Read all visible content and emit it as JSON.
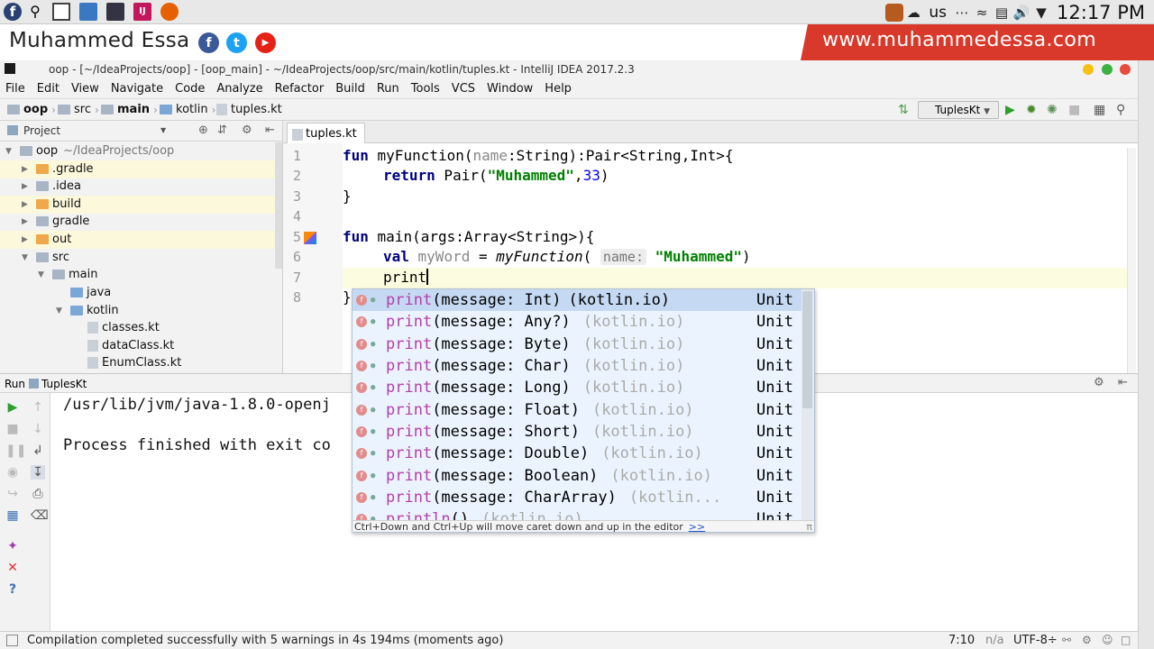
{
  "system_tray": {
    "language": "us",
    "clock": "12:17 PM"
  },
  "banner": {
    "name": "Muhammed Essa",
    "website": "www.muhammedessa.com",
    "social": [
      "f",
      "t",
      "▶"
    ]
  },
  "window": {
    "title": "oop - [~/IdeaProjects/oop] - [oop_main] - ~/IdeaProjects/oop/src/main/kotlin/tuples.kt - IntelliJ IDEA 2017.2.3"
  },
  "menu": [
    "File",
    "Edit",
    "View",
    "Navigate",
    "Code",
    "Analyze",
    "Refactor",
    "Build",
    "Run",
    "Tools",
    "VCS",
    "Window",
    "Help"
  ],
  "breadcrumbs": [
    "oop",
    "src",
    "main",
    "kotlin",
    "tuples.kt"
  ],
  "run_config": "TuplesKt",
  "project_panel": {
    "title": "Project",
    "tree": [
      {
        "label": "oop",
        "note": "~/IdeaProjects/oop"
      },
      {
        "label": ".gradle"
      },
      {
        "label": ".idea"
      },
      {
        "label": "build"
      },
      {
        "label": "gradle"
      },
      {
        "label": "out"
      },
      {
        "label": "src"
      },
      {
        "label": "main"
      },
      {
        "label": "java"
      },
      {
        "label": "kotlin"
      },
      {
        "label": "classes.kt"
      },
      {
        "label": "dataClass.kt"
      },
      {
        "label": "EnumClass.kt"
      }
    ]
  },
  "editor": {
    "tab": "tuples.kt",
    "line_numbers": [
      "1",
      "2",
      "3",
      "4",
      "5",
      "6",
      "7",
      "8"
    ],
    "code": {
      "l1_fun": "fun",
      "l1_name": " myFunction(",
      "l1_param": "name",
      "l1_rest": ":String):Pair<String,Int>{",
      "l2_return": "return",
      "l2_pair": " Pair(",
      "l2_str": "\"Muhammed\"",
      "l2_comma": ",",
      "l2_num": "33",
      "l2_close": ")",
      "l3": "}",
      "l5_fun": "fun",
      "l5_rest": " main(args:Array<String>){",
      "l6_val": "val",
      "l6_var": " myWord",
      "l6_eq": " = ",
      "l6_call": "myFunction",
      "l6_paren": "( ",
      "l6_hint": "name:",
      "l6_str": "\"Muhammed\"",
      "l6_close": ")",
      "l7": "print",
      "l8": "}"
    }
  },
  "completion": {
    "items": [
      {
        "name": "print",
        "sig": "(message: Int)",
        "pkg": "(kotlin.io)",
        "type": "Unit"
      },
      {
        "name": "print",
        "sig": "(message: Any?)",
        "pkg": "(kotlin.io)",
        "type": "Unit"
      },
      {
        "name": "print",
        "sig": "(message: Byte)",
        "pkg": "(kotlin.io)",
        "type": "Unit"
      },
      {
        "name": "print",
        "sig": "(message: Char)",
        "pkg": "(kotlin.io)",
        "type": "Unit"
      },
      {
        "name": "print",
        "sig": "(message: Long)",
        "pkg": "(kotlin.io)",
        "type": "Unit"
      },
      {
        "name": "print",
        "sig": "(message: Float)",
        "pkg": "(kotlin.io)",
        "type": "Unit"
      },
      {
        "name": "print",
        "sig": "(message: Short)",
        "pkg": "(kotlin.io)",
        "type": "Unit"
      },
      {
        "name": "print",
        "sig": "(message: Double)",
        "pkg": "(kotlin.io)",
        "type": "Unit"
      },
      {
        "name": "print",
        "sig": "(message: Boolean)",
        "pkg": "(kotlin.io)",
        "type": "Unit"
      },
      {
        "name": "print",
        "sig": "(message: CharArray)",
        "pkg": "(kotlin...",
        "type": "Unit"
      },
      {
        "name": "println",
        "sig": "()",
        "pkg": "(kotlin.io)",
        "type": "Unit"
      }
    ],
    "footer": "Ctrl+Down and Ctrl+Up will move caret down and up in the editor",
    "footer_link": ">>"
  },
  "run_panel": {
    "label": "Run",
    "config": "TuplesKt",
    "console": [
      "/usr/lib/jvm/java-1.8.0-openj",
      "Process finished with exit co"
    ]
  },
  "status_bar": {
    "message": "Compilation completed successfully with 5 warnings in 4s 194ms (moments ago)",
    "position": "7:10",
    "na": "n/a",
    "encoding": "UTF-8÷"
  },
  "colors": {
    "banner_red": "#d9392b",
    "facebook": "#3b5998",
    "twitter": "#1da1f2",
    "youtube": "#e62117",
    "keyword": "#000080",
    "string": "#008000",
    "number": "#0000ff",
    "completion_name": "#b33fa8"
  }
}
